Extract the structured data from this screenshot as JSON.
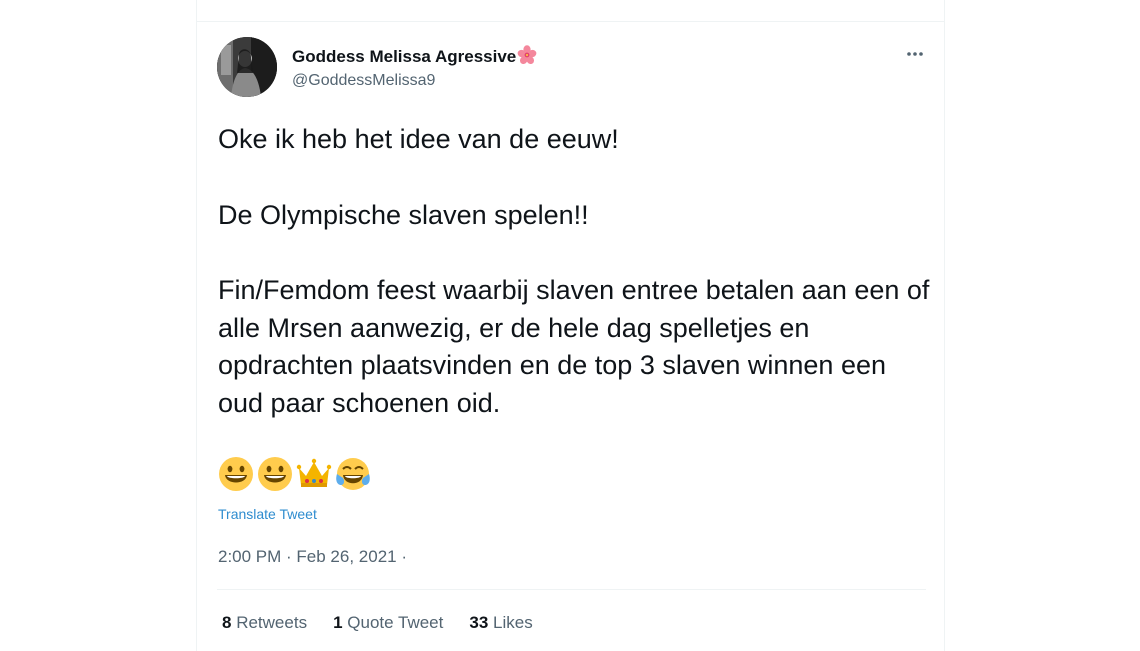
{
  "tweet": {
    "author": {
      "display_name": "Goddess Melissa Agressive",
      "name_emoji": "hibiscus-icon",
      "handle": "@GoddessMelissa9"
    },
    "paragraphs": [
      "Oke ik heb het idee van de eeuw!",
      "De Olympische slaven spelen!!",
      "Fin/Femdom feest waarbij slaven entree betalen aan een of alle Mrsen aanwezig, er de hele dag spelletjes en opdrachten plaatsvinden en de top 3 slaven winnen een oud paar schoenen oid."
    ],
    "emojis": [
      "grinning-face-icon",
      "grinning-face-icon",
      "crown-icon",
      "tears-of-joy-icon"
    ],
    "translate_label": "Translate Tweet",
    "timestamp": "2:00 PM · Feb 26, 2021 ·",
    "stats": {
      "retweets_count": "8",
      "retweets_label": "Retweets",
      "quotes_count": "1",
      "quotes_label": "Quote Tweet",
      "likes_count": "33",
      "likes_label": "Likes"
    }
  },
  "colors": {
    "text_primary": "#0f1419",
    "text_secondary": "#536471",
    "link": "#2e8ccf",
    "divider": "#eff3f4"
  }
}
